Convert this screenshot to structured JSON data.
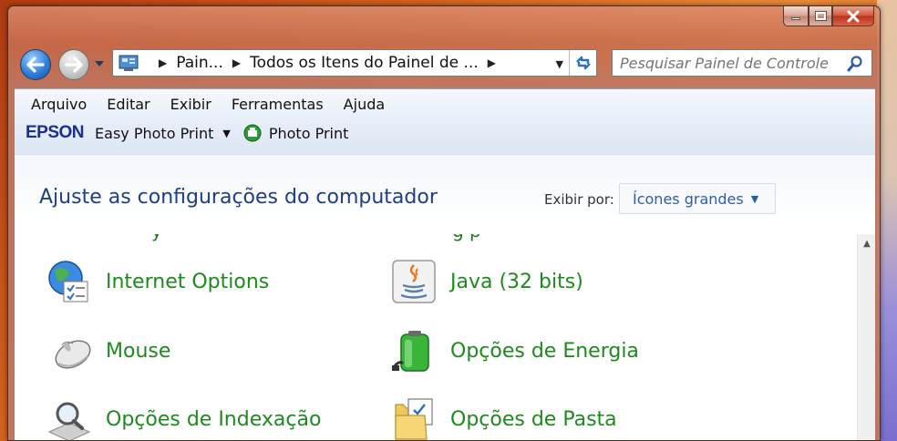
{
  "address": {
    "crumbs": [
      "Pain...",
      "Todos os Itens do Painel de ..."
    ]
  },
  "search": {
    "placeholder": "Pesquisar Painel de Controle"
  },
  "menu": {
    "items": [
      "Arquivo",
      "Editar",
      "Exibir",
      "Ferramentas",
      "Ajuda"
    ]
  },
  "commandbar": {
    "brand": "EPSON",
    "easy_photo_print": "Easy Photo Print",
    "photo_print": "Photo Print"
  },
  "header": {
    "title": "Ajuste as configurações do computador",
    "view_label": "Exibir por:",
    "view_value": "Ícones grandes"
  },
  "items": [
    {
      "label": "Internet Options",
      "icon": "internet-options-icon"
    },
    {
      "label": "Java (32 bits)",
      "icon": "java-icon"
    },
    {
      "label": "Mouse",
      "icon": "mouse-icon"
    },
    {
      "label": "Opções de Energia",
      "icon": "battery-icon"
    },
    {
      "label": "Opções de Indexação",
      "icon": "indexing-icon"
    },
    {
      "label": "Opções de Pasta",
      "icon": "folder-options-icon"
    }
  ],
  "colors": {
    "link_green": "#1e8a1e",
    "title_blue": "#1e3f86",
    "accent_blue": "#2a5fa6"
  }
}
